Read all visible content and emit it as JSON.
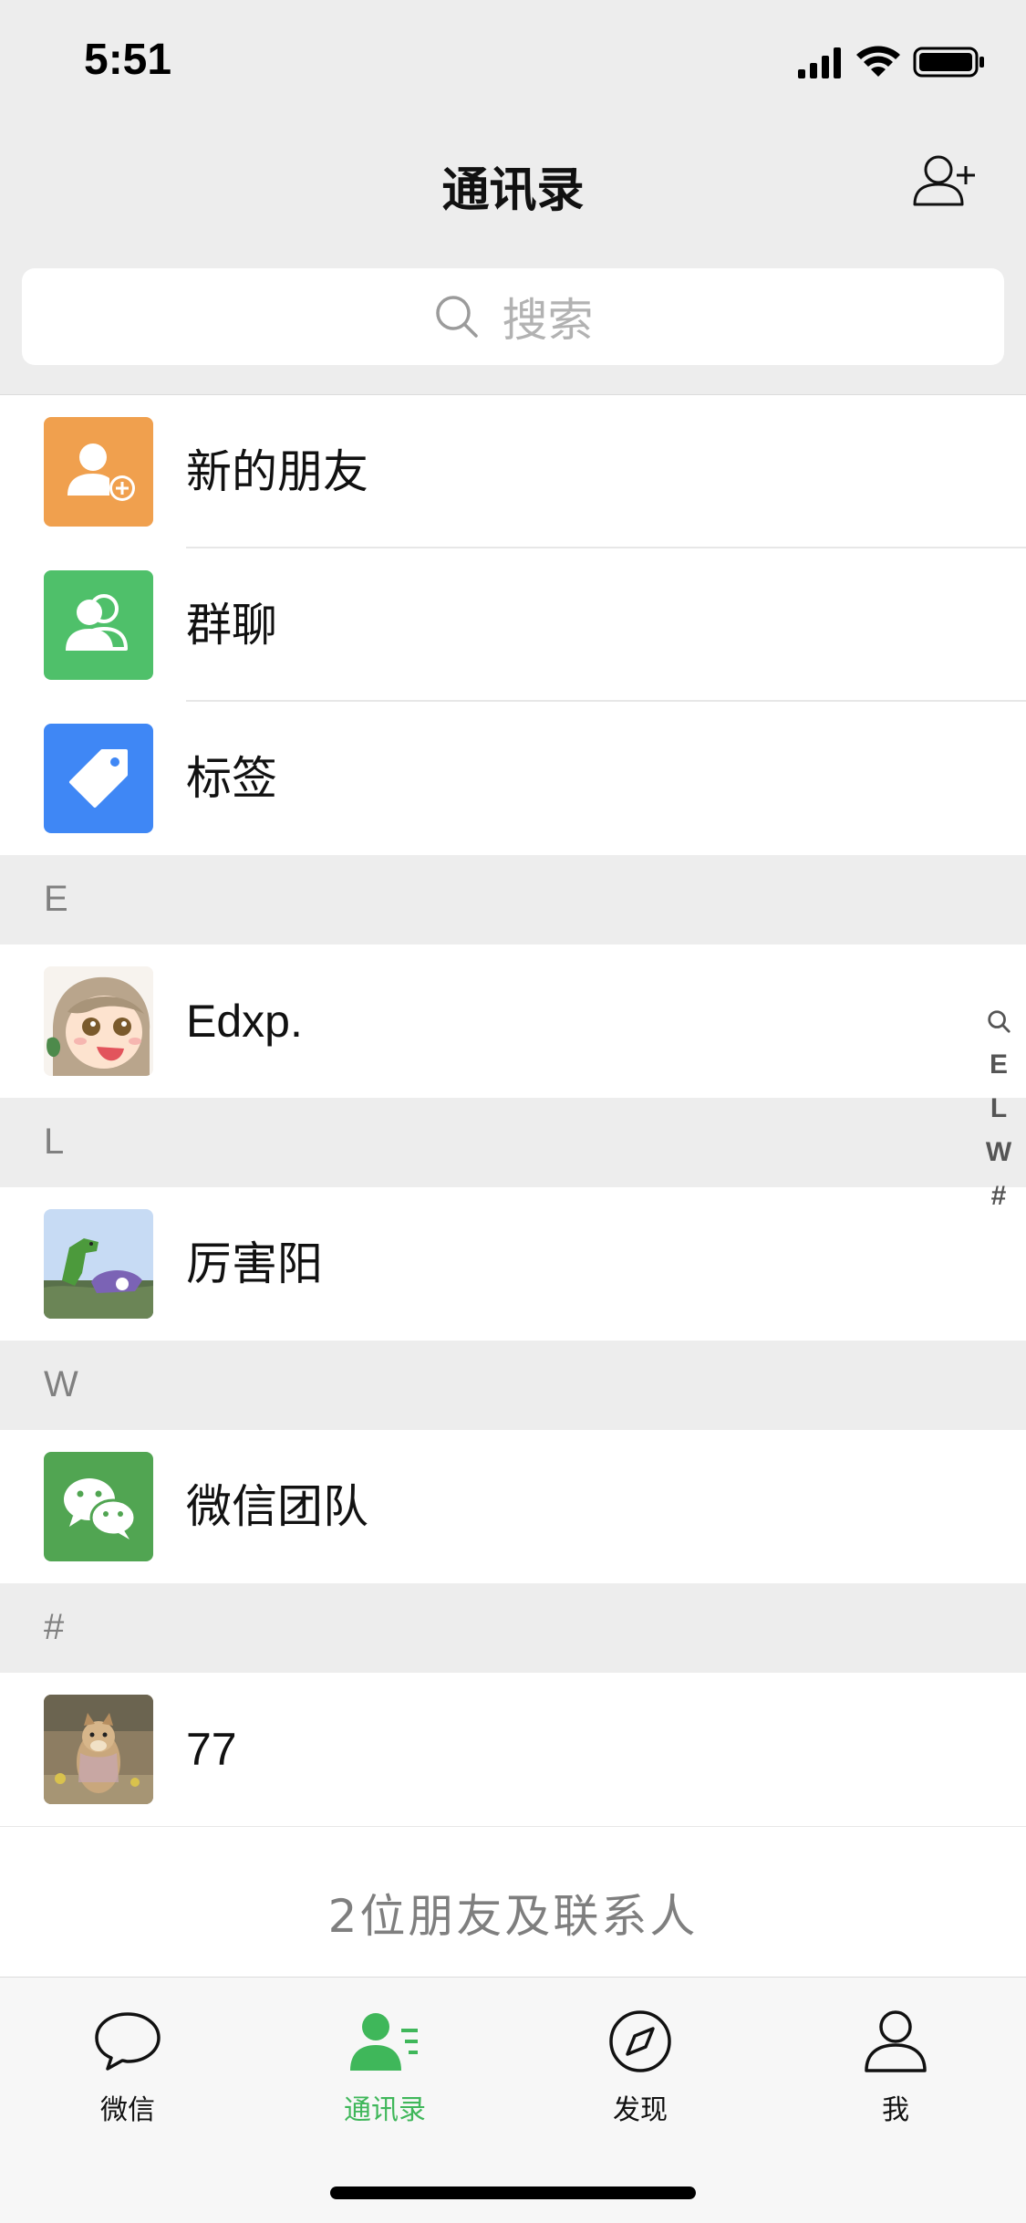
{
  "status_bar": {
    "time": "5:51"
  },
  "nav": {
    "title": "通讯录",
    "add_friend_icon": "add-contact-icon"
  },
  "search": {
    "placeholder": "搜索"
  },
  "function_rows": [
    {
      "label": "新的朋友",
      "icon": "new-friend-icon",
      "color": "#f0a04e"
    },
    {
      "label": "群聊",
      "icon": "group-chat-icon",
      "color": "#4fc06a"
    },
    {
      "label": "标签",
      "icon": "tag-icon",
      "color": "#3f87f5"
    }
  ],
  "sections": [
    {
      "letter": "E",
      "contacts": [
        {
          "name": "Edxp."
        }
      ]
    },
    {
      "letter": "L",
      "contacts": [
        {
          "name": "厉害阳"
        }
      ]
    },
    {
      "letter": "W",
      "contacts": [
        {
          "name": "微信团队"
        }
      ]
    },
    {
      "letter": "#",
      "contacts": [
        {
          "name": "77"
        }
      ]
    }
  ],
  "footer": {
    "count_text": "2位朋友及联系人"
  },
  "index_bar": [
    "E",
    "L",
    "W",
    "#"
  ],
  "tabs": [
    {
      "label": "微信",
      "icon": "chat-bubble-icon",
      "active": false
    },
    {
      "label": "通讯录",
      "icon": "contacts-icon",
      "active": true
    },
    {
      "label": "发现",
      "icon": "compass-icon",
      "active": false
    },
    {
      "label": "我",
      "icon": "profile-icon",
      "active": false
    }
  ],
  "colors": {
    "accent": "#3fb75a",
    "background": "#ededed"
  }
}
